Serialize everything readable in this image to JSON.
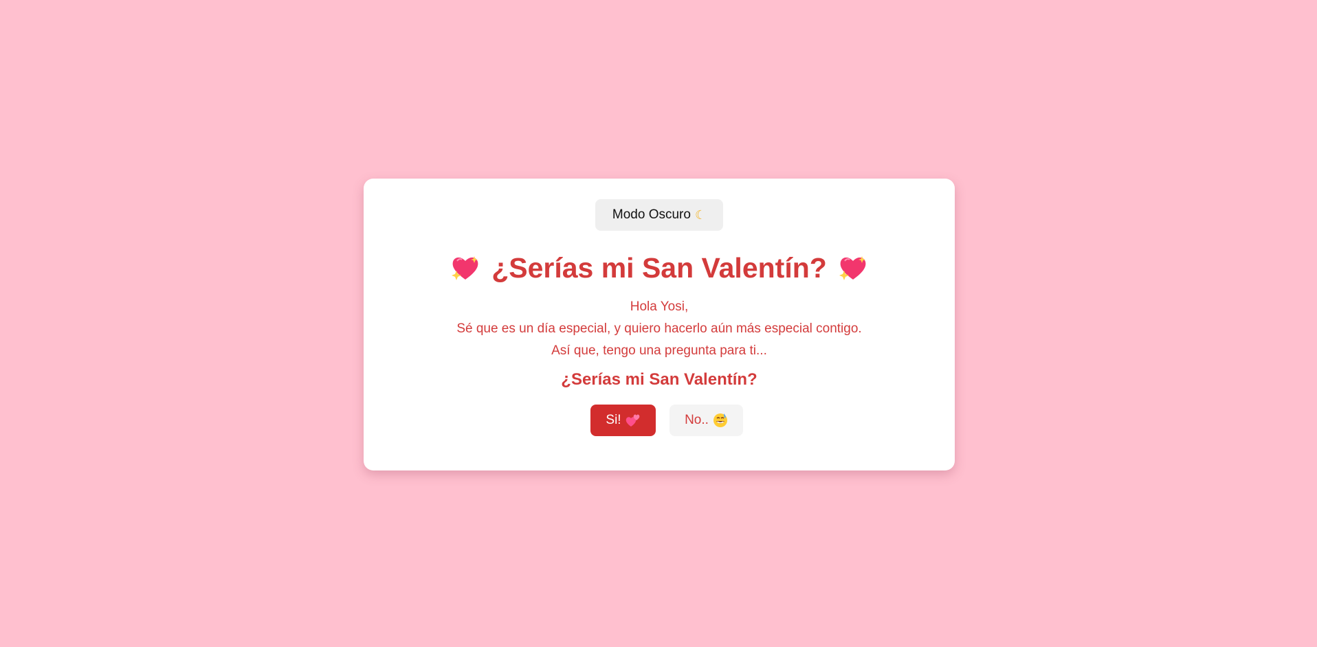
{
  "theme_toggle": {
    "label": "Modo Oscuro",
    "icon": "moon-icon",
    "icon_glyph": "☾"
  },
  "heading": {
    "text": "¿Serías mi San Valentín?",
    "left_icon": "sparkling-heart-icon",
    "right_icon": "sparkling-heart-icon"
  },
  "message": {
    "greeting": "Hola Yosi,",
    "line1": "Sé que es un día especial, y quiero hacerlo aún más especial contigo.",
    "line2": "Así que, tengo una pregunta para ti..."
  },
  "question": "¿Serías mi San Valentín?",
  "buttons": {
    "yes": {
      "label": "Si!",
      "icon": "two-hearts-icon"
    },
    "no": {
      "label": "No..",
      "icon": "grinning-sweat-icon"
    }
  },
  "colors": {
    "background": "#ffc0cf",
    "accent": "#d33b3b",
    "yes_button": "#d22d2d",
    "card": "#ffffff"
  }
}
